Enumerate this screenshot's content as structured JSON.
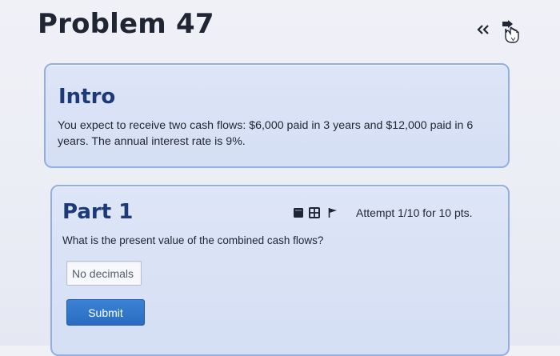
{
  "header": {
    "title": "Problem 47",
    "prev_icon": "double-chevron-left-icon",
    "next_icon": "pointer-hand-icon"
  },
  "intro": {
    "title": "Intro",
    "text": "You expect to receive two cash flows: $6,000 paid in 3 years and $12,000 paid in 6 years. The annual interest rate is 9%."
  },
  "part": {
    "title": "Part 1",
    "tools": [
      "note-icon",
      "calculator-icon",
      "flag-icon"
    ],
    "attempt": "Attempt 1/10 for 10 pts.",
    "question": "What is the present value of the combined cash flows?",
    "input_placeholder": "No decimals",
    "input_value": "",
    "submit_label": "Submit"
  },
  "colors": {
    "accent": "#2a6dc0",
    "card_border": "#93aee0",
    "card_bg": "#d9e2f6",
    "heading": "#1d3a78"
  }
}
